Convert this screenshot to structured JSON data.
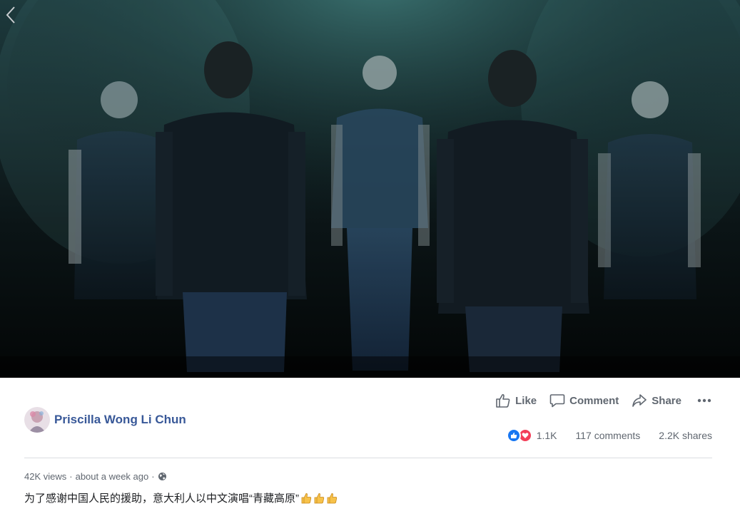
{
  "video": {
    "back_icon": "chevron-left-icon"
  },
  "actions": {
    "like_label": "Like",
    "comment_label": "Comment",
    "share_label": "Share",
    "more_icon": "more-dots-icon"
  },
  "author": {
    "name": "Priscilla Wong Li Chun"
  },
  "stats": {
    "reaction_count": "1.1K",
    "comments": "117 comments",
    "shares": "2.2K shares",
    "reaction_icons": [
      "like-reaction-icon",
      "love-reaction-icon"
    ]
  },
  "meta": {
    "views": "42K views",
    "separator": "·",
    "time": "about a week ago",
    "separator2": "·",
    "privacy_icon": "globe-icon"
  },
  "caption": {
    "text": "为了感谢中国人民的援助，意大利人以中文演唱“青藏高原”",
    "emoji": [
      "thumbs-up-emoji",
      "thumbs-up-emoji",
      "thumbs-up-emoji"
    ]
  },
  "colors": {
    "link": "#385898",
    "muted": "#606770",
    "like": "#1877f2",
    "love": "#f33e58"
  }
}
